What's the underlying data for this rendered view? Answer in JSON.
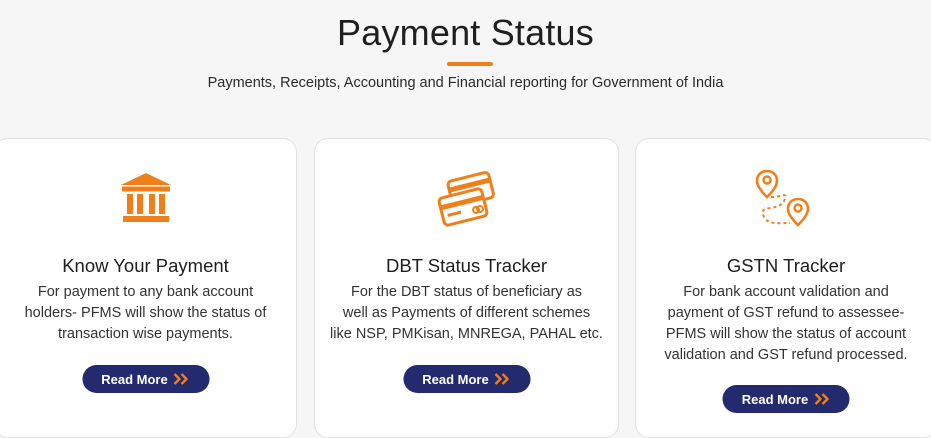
{
  "header": {
    "title": "Payment Status",
    "subtitle": "Payments, Receipts, Accounting and Financial reporting for Government of India"
  },
  "colors": {
    "accent": "#ef7f1a",
    "button": "#232a6e",
    "background": "#f6f6f7",
    "card": "#ffffff"
  },
  "cards": [
    {
      "icon": "bank-icon",
      "title": "Know Your Payment",
      "description_lines": [
        "For payment to any bank account",
        "holders- PFMS will show the status of",
        "transaction wise payments."
      ],
      "button_label": "Read More"
    },
    {
      "icon": "credit-cards-icon",
      "title": "DBT Status Tracker",
      "description_lines": [
        "For the DBT status of beneficiary as",
        "well as Payments of different schemes",
        "like NSP, PMKisan, MNREGA, PAHAL etc."
      ],
      "button_label": "Read More"
    },
    {
      "icon": "route-pins-icon",
      "title": "GSTN Tracker",
      "description_lines": [
        "For bank account validation and",
        "payment of GST refund to assessee-",
        "PFMS will show the status of account",
        "validation and GST refund processed."
      ],
      "button_label": "Read More"
    }
  ]
}
